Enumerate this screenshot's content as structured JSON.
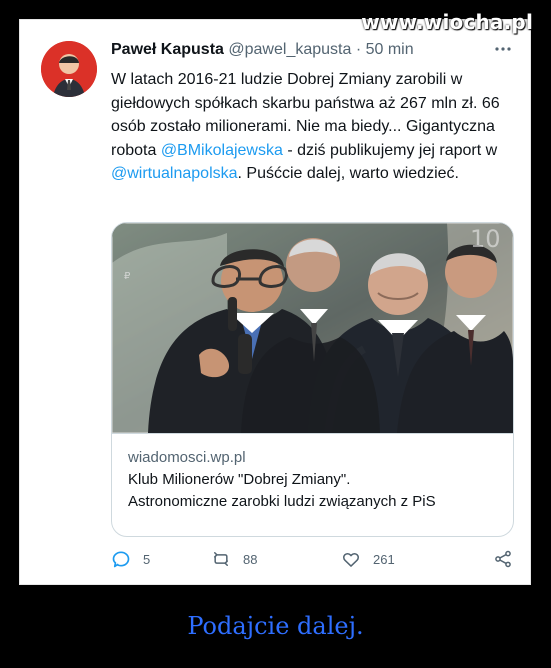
{
  "watermark": "www.wiocha.pl",
  "tweet": {
    "author_name": "Paweł Kapusta",
    "author_handle": "@pawel_kapusta",
    "dot": "·",
    "time": "50 min",
    "text_parts": [
      "W latach 2016-21 ludzie Dobrej Zmiany zarobili w giełdowych spółkach skarbu państwa aż 267 mln zł. 66 osób zostało milionerami. Nie ma biedy... Gigantyczna robota ",
      "@BMikolajewska",
      " - dziś publikujemy jej raport w ",
      "@wirtualnapolska",
      ". Puśćcie dalej, warto wiedzieć."
    ]
  },
  "link_card": {
    "domain": "wiadomosci.wp.pl",
    "title": "Klub Milionerów \"Dobrej Zmiany\".",
    "description": "Astronomiczne zarobki ludzi związanych z PiS"
  },
  "actions": {
    "replies": "5",
    "retweets": "88",
    "likes": "261"
  },
  "caption": "Podajcie dalej.",
  "colors": {
    "accent": "#1d9bf0",
    "text": "#0f1419",
    "muted": "#536471",
    "caption": "#2e6eff",
    "background": "#000000",
    "card": "#ffffff"
  },
  "icons": {
    "reply": "reply-icon",
    "retweet": "retweet-icon",
    "like": "heart-icon",
    "share": "share-icon",
    "more": "more-icon"
  }
}
